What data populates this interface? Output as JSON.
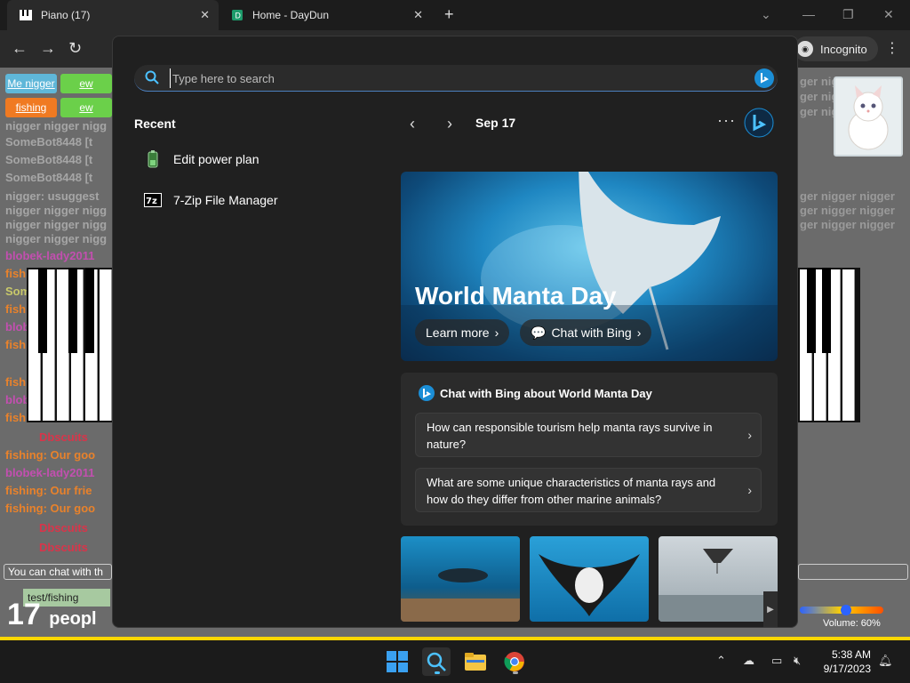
{
  "browser": {
    "tabs": [
      {
        "title": "Piano (17)"
      },
      {
        "title": "Home - DayDun"
      }
    ],
    "incognito_label": "Incognito"
  },
  "background_page": {
    "chips": [
      "Me nigger",
      "ew",
      "fishing",
      "ew"
    ],
    "chat_lines": [
      "nigger nigger nigg",
      "SomeBot8448 [t",
      "SomeBot8448 [t",
      "SomeBot8448 [t",
      "nigger: usuggest",
      "nigger nigger nigg",
      "nigger nigger nigg",
      "nigger nigger nigg",
      "blobek-lady2011",
      "fish",
      "Som",
      "fish",
      "blob",
      "fish",
      "fish",
      "blob",
      "fish",
      "Dbscuits",
      "fishing:  Our goo",
      "blobek-lady2011",
      "fishing:  Our frie",
      "fishing:  Our goo",
      "Dbscuits",
      "Dbscuits"
    ],
    "right_lines": [
      "ger nigger",
      "ger nigger",
      "ger nigger",
      "ger nigger nigger",
      "ger nigger nigger",
      "ger nigger nigger"
    ],
    "chat_placeholder": "You can chat with th",
    "channel": "test/fishing",
    "people_count": "17",
    "people_label": "peopl",
    "volume": "Volume: 60%",
    "volume_level": 0.6
  },
  "search_panel": {
    "search_placeholder": "Type here to search",
    "recent_heading": "Recent",
    "recent_items": [
      {
        "label": "Edit power plan",
        "icon": "battery-icon"
      },
      {
        "label": "7-Zip File Manager",
        "icon": "7zip-icon"
      }
    ],
    "date": "Sep 17",
    "more": "···",
    "hero": {
      "title": "World Manta Day",
      "learn_more": "Learn more",
      "chat_with_bing": "Chat with Bing"
    },
    "chat_card": {
      "heading": "Chat with Bing about World Manta Day",
      "questions": [
        "How can responsible tourism help manta rays survive in nature?",
        "What are some unique characteristics of manta rays and how do they differ from other marine animals?"
      ]
    }
  },
  "taskbar": {
    "time": "5:38 AM",
    "date": "9/17/2023"
  }
}
